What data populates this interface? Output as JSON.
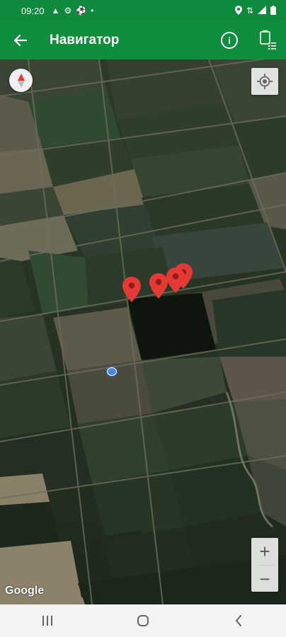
{
  "status_bar": {
    "time": "09:20",
    "left_icons": [
      "navigation-icon",
      "gear-icon",
      "soccer-ball-icon",
      "dot-icon"
    ],
    "right_icons": [
      "location-icon",
      "data-transfer-icon",
      "signal-icon",
      "battery-icon"
    ]
  },
  "app_bar": {
    "back_icon": "arrow-left-icon",
    "title": "Навигатор",
    "info_icon": "info-icon",
    "list_icon": "checklist-icon",
    "color": "#0f8f3e"
  },
  "map": {
    "type": "satellite",
    "attribution": "Google",
    "controls": {
      "compass_icon": "compass-icon",
      "my_location_icon": "crosshair-icon",
      "zoom_in": "+",
      "zoom_out": "−"
    },
    "markers_count": 4,
    "marker_color": "#e53935",
    "my_location_color": "#4285f4"
  },
  "nav_bar": {
    "buttons": [
      "recent-apps-icon",
      "home-icon",
      "back-icon"
    ]
  }
}
